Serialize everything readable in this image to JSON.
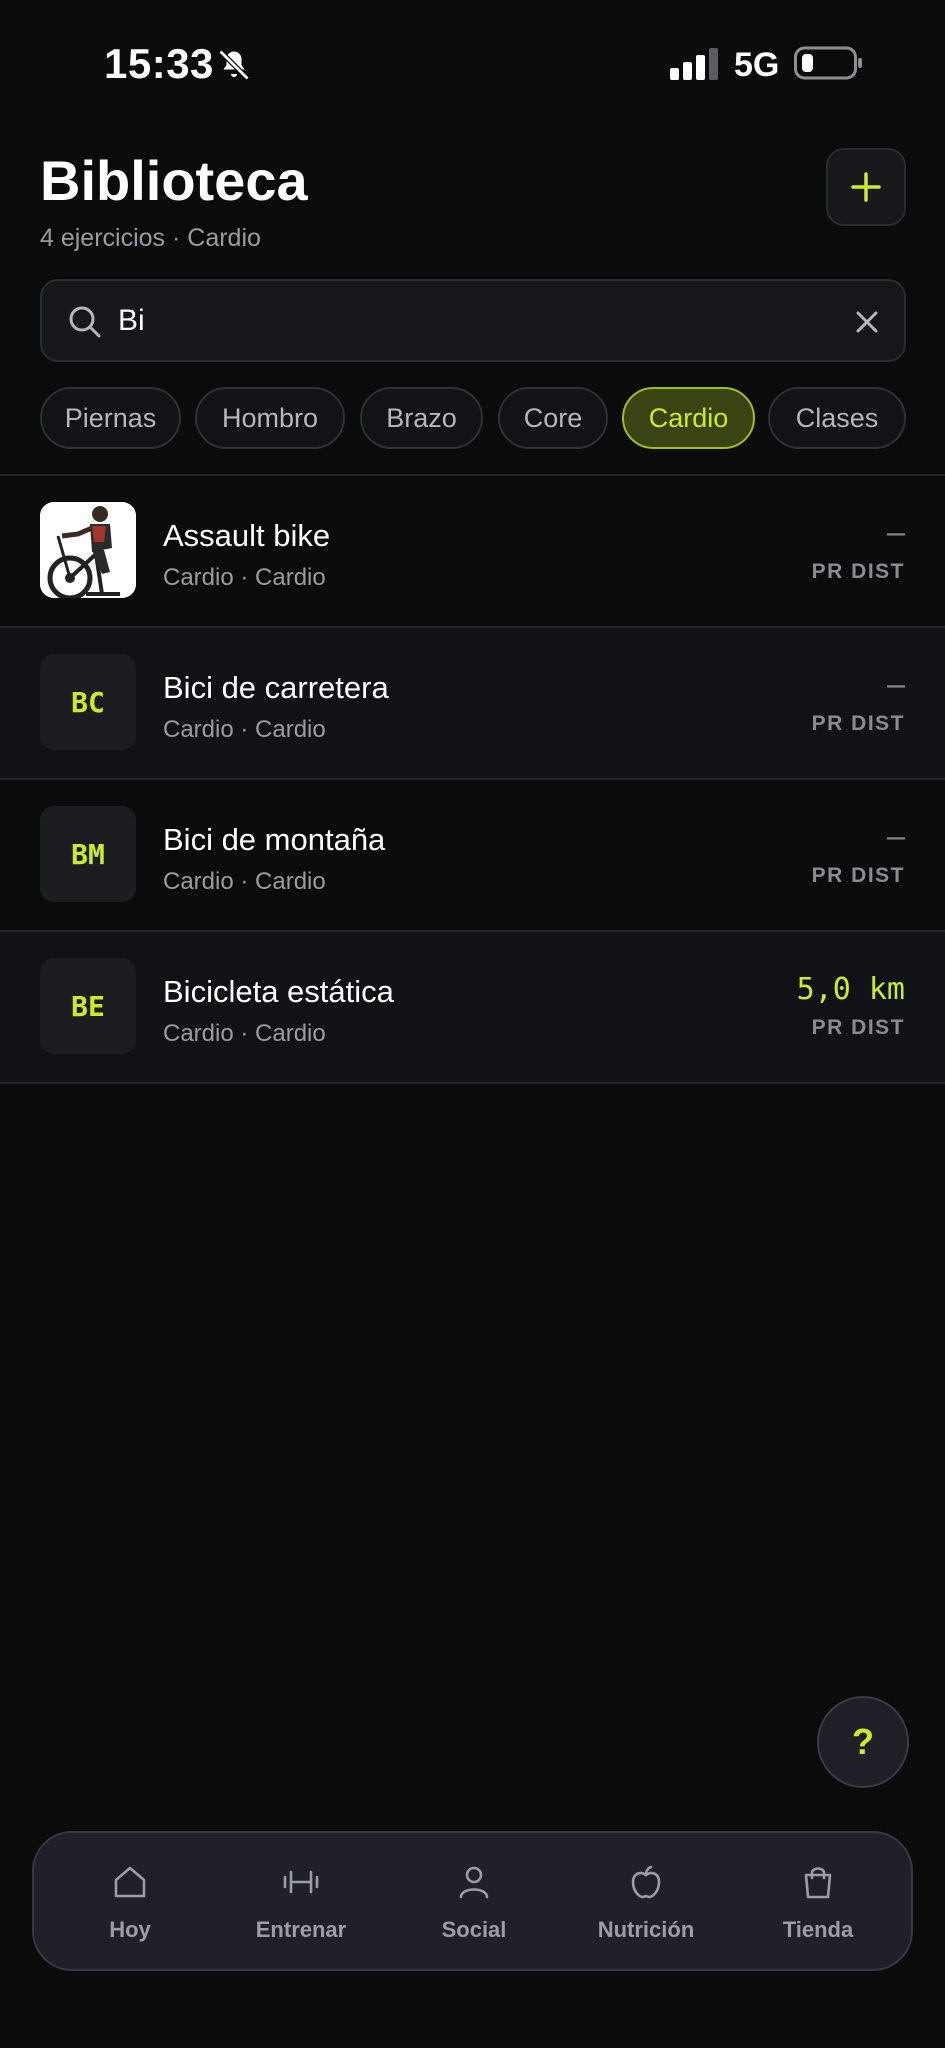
{
  "status_bar": {
    "time": "15:33",
    "network": "5G",
    "icons": [
      "bell-muted-icon",
      "signal-icon",
      "battery-icon"
    ]
  },
  "header": {
    "title": "Biblioteca",
    "subtitle": "4 ejercicios · Cardio",
    "add_icon": "plus-icon"
  },
  "search": {
    "value": "Bi",
    "placeholder": "",
    "icon": "search-icon",
    "clear_icon": "close-icon"
  },
  "filters": [
    {
      "label": "Piernas",
      "active": false
    },
    {
      "label": "Hombro",
      "active": false
    },
    {
      "label": "Brazo",
      "active": false
    },
    {
      "label": "Core",
      "active": false
    },
    {
      "label": "Cardio",
      "active": true
    },
    {
      "label": "Clases",
      "active": false
    }
  ],
  "exercises": [
    {
      "name": "Assault bike",
      "meta": "Cardio · Cardio",
      "thumb": "assault-bike-image",
      "value": "–",
      "label": "PR DIST"
    },
    {
      "name": "Bici de carretera",
      "meta": "Cardio · Cardio",
      "initials": "BC",
      "value": "–",
      "label": "PR DIST"
    },
    {
      "name": "Bici de montaña",
      "meta": "Cardio · Cardio",
      "initials": "BM",
      "value": "–",
      "label": "PR DIST"
    },
    {
      "name": "Bicicleta estática",
      "meta": "Cardio · Cardio",
      "initials": "BE",
      "value": "5,0 km",
      "label": "PR DIST"
    }
  ],
  "help": {
    "label": "?"
  },
  "nav": [
    {
      "label": "Hoy",
      "icon": "home-icon"
    },
    {
      "label": "Entrenar",
      "icon": "dumbbell-icon"
    },
    {
      "label": "Social",
      "icon": "user-icon"
    },
    {
      "label": "Nutrición",
      "icon": "apple-icon"
    },
    {
      "label": "Tienda",
      "icon": "shopping-bag-icon"
    }
  ],
  "colors": {
    "accent": "#cbec26",
    "background": "#0b0b0c",
    "muted": "#9a9ca3"
  }
}
